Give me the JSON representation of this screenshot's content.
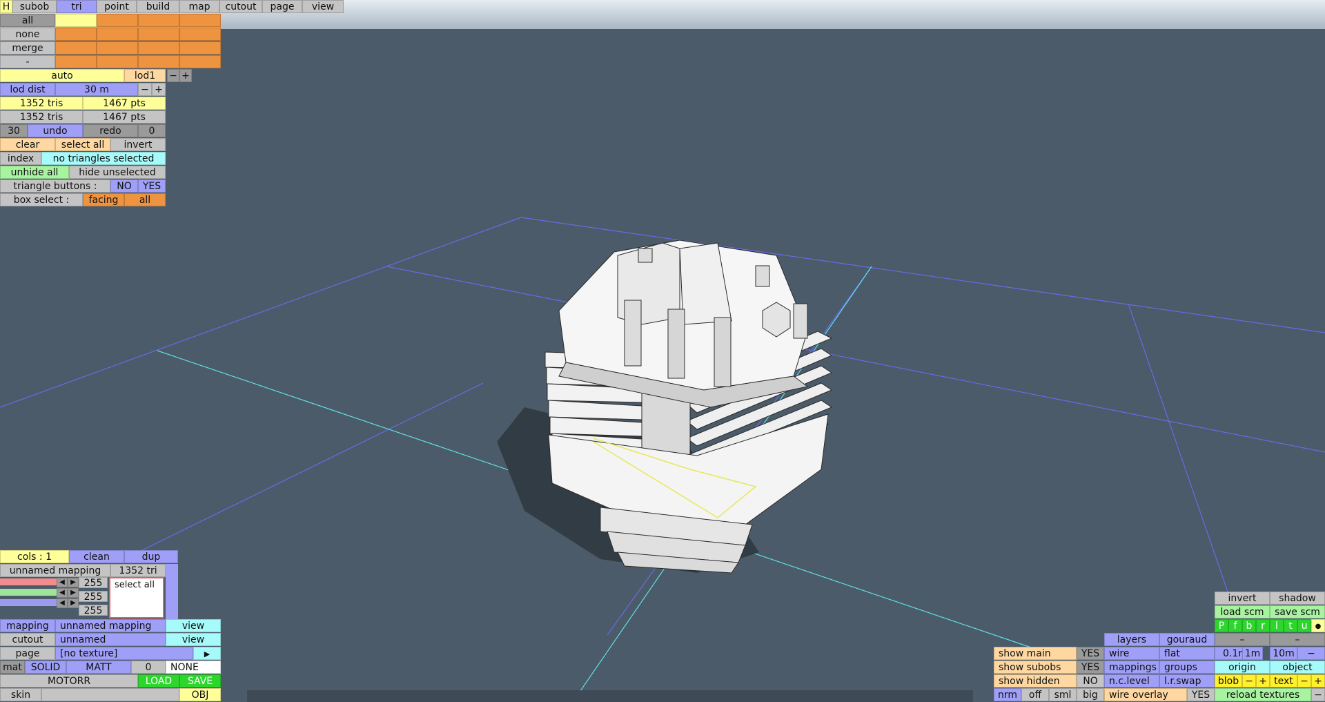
{
  "menu": {
    "h": "H",
    "items": [
      "subob",
      "tri",
      "point",
      "build",
      "map",
      "cutout",
      "page",
      "view"
    ]
  },
  "subob_panel": {
    "rows": [
      "all",
      "none",
      "merge",
      "-"
    ]
  },
  "lod": {
    "auto": "auto",
    "level": "lod1",
    "minus": "−",
    "plus": "+",
    "dist_label": "lod dist",
    "dist_value": "30 m"
  },
  "counts": [
    {
      "tris": "1352 tris",
      "pts": "1467 pts"
    },
    {
      "tris": "1352 tris",
      "pts": "1467 pts"
    }
  ],
  "history": {
    "undo_count": "30",
    "undo": "undo",
    "redo": "redo",
    "redo_count": "0"
  },
  "selection": {
    "clear": "clear",
    "select_all": "select all",
    "invert": "invert",
    "index": "index",
    "status": "no triangles selected",
    "unhide_all": "unhide all",
    "hide_unselected": "hide unselected",
    "triangle_buttons_label": "triangle buttons :",
    "no": "NO",
    "yes": "YES",
    "box_select_label": "box select :",
    "facing": "facing",
    "all": "all"
  },
  "lower_left": {
    "cols": "cols : 1",
    "clean": "clean",
    "dup": "dup",
    "mapping_name": "unnamed mapping",
    "tri_count": "1352 tri",
    "rgb": [
      "255",
      "255",
      "255"
    ],
    "select_all": "select all",
    "mapping_label": "mapping",
    "mapping_value": "unnamed mapping",
    "view": "view",
    "cutout_label": "cutout",
    "cutout_value": "unnamed",
    "page_label": "page",
    "page_value": "[no texture]",
    "arrow": "▶",
    "mat": "mat",
    "solid": "SOLID",
    "matt": "MATT",
    "mat_num": "0",
    "none": "NONE",
    "motorr": "MOTORR",
    "load": "LOAD",
    "save": "SAVE",
    "skin": "skin",
    "obj": "OBJ"
  },
  "lower_right": {
    "invert": "invert",
    "shadow": "shadow",
    "load_scm": "load scm",
    "save_scm": "save scm",
    "flags": [
      "P",
      "f",
      "b",
      "r",
      "l",
      "t",
      "u"
    ],
    "dot": "●",
    "layers": "layers",
    "gouraud": "gouraud",
    "dash": "–",
    "show_main": "show main",
    "show_main_val": "YES",
    "wire": "wire",
    "flat": "flat",
    "g01": "0.1m",
    "g1": "1m",
    "g10": "10m",
    "gminus": "−",
    "show_subobs": "show subobs",
    "show_subobs_val": "YES",
    "mappings": "mappings",
    "groups": "groups",
    "origin": "origin",
    "object": "object",
    "show_hidden": "show hidden",
    "show_hidden_val": "NO",
    "nclevel": "n.c.level",
    "lrswap": "l.r.swap",
    "blob": "blob",
    "text": "text",
    "nrm": "nrm",
    "off": "off",
    "sml": "sml",
    "big": "big",
    "wire_overlay": "wire overlay",
    "wire_overlay_val": "YES",
    "reload_textures": "reload textures"
  }
}
